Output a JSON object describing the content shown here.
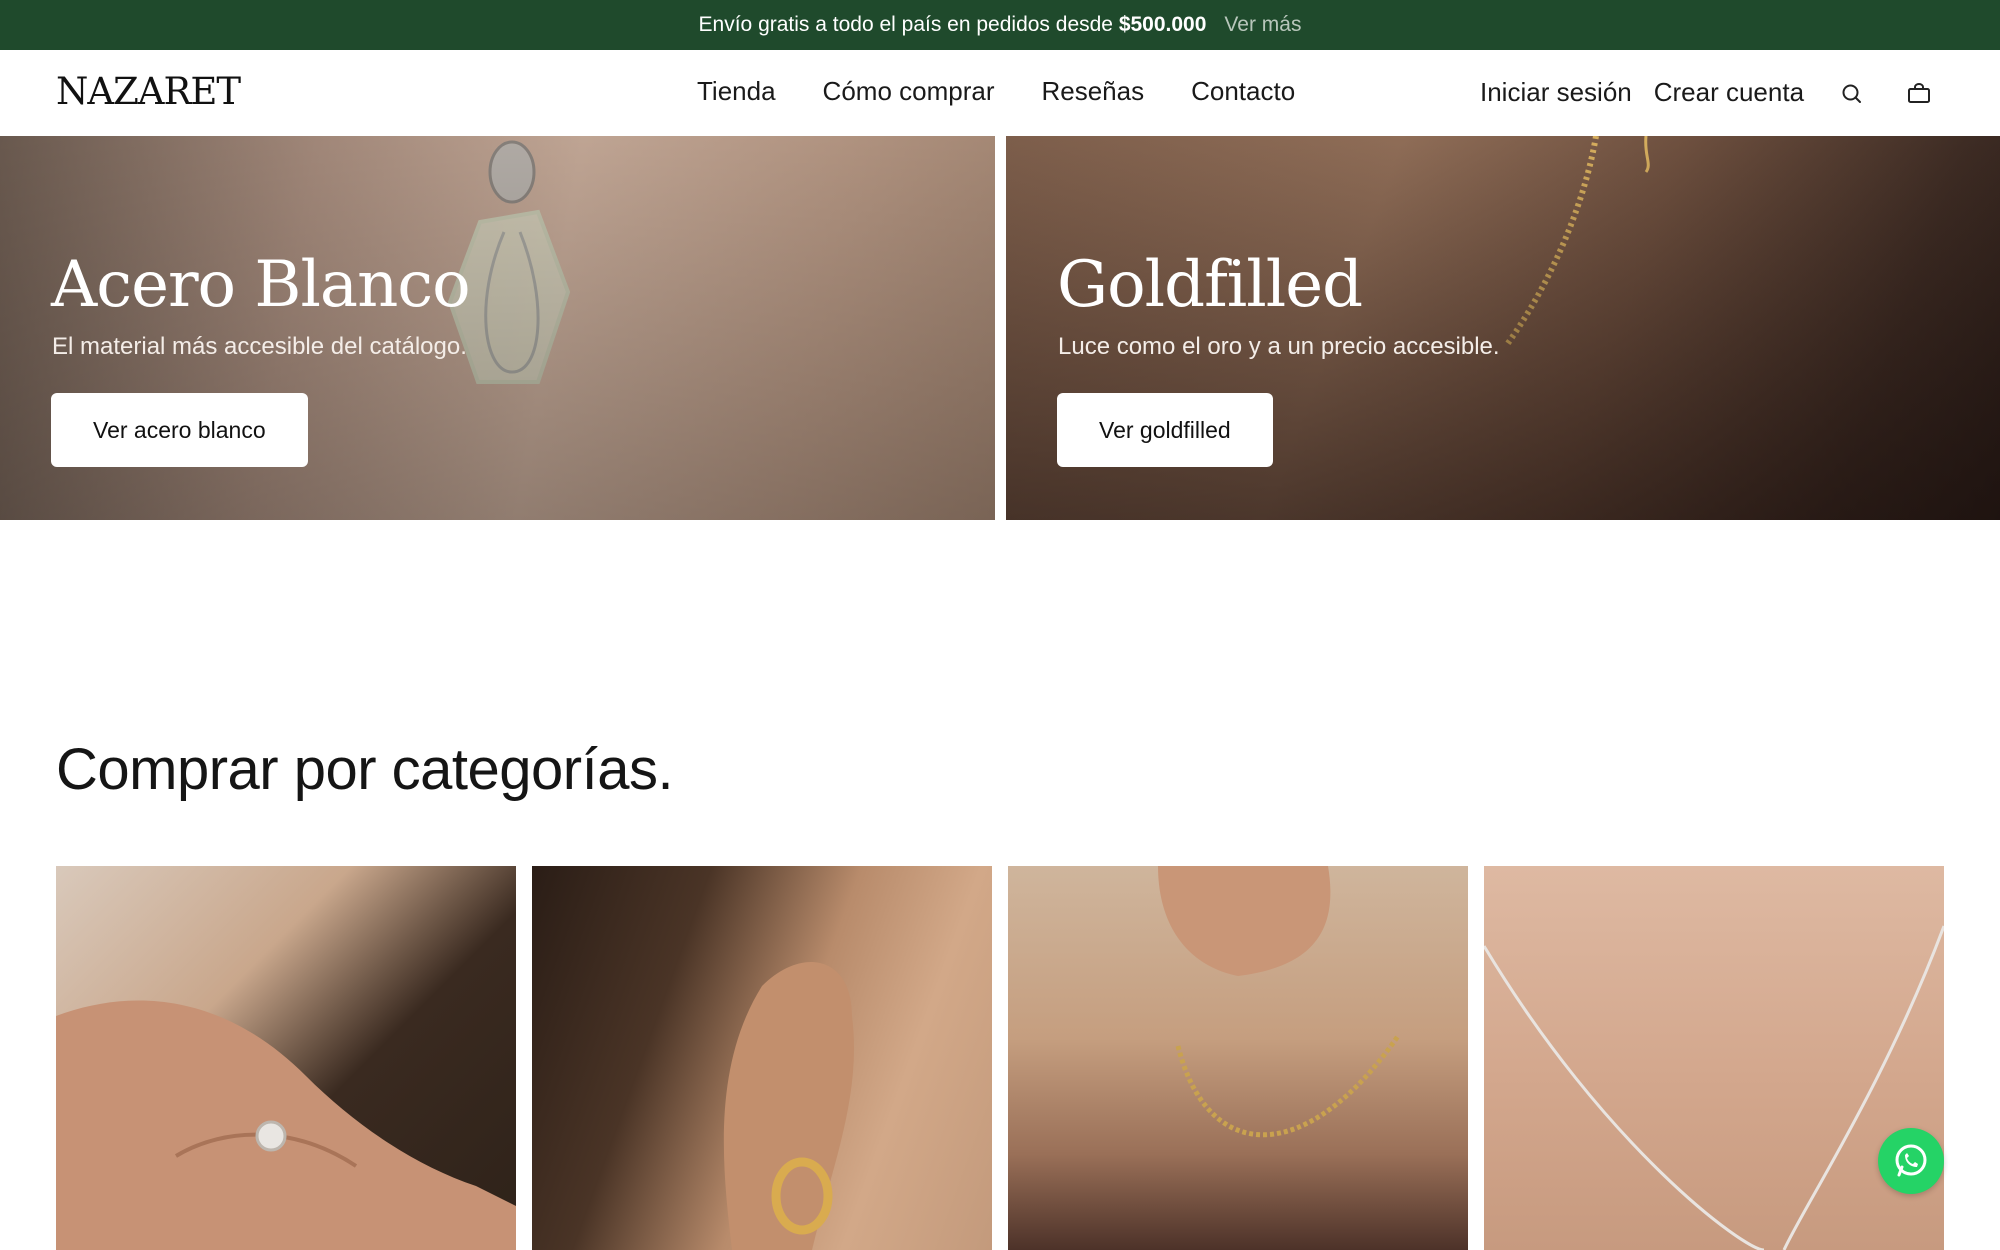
{
  "announcement": {
    "text": "Envío gratis a todo el país en pedidos desde",
    "amount": "$500.000",
    "link": "Ver más"
  },
  "header": {
    "logo": "NAZARET",
    "nav": [
      "Tienda",
      "Cómo comprar",
      "Reseñas",
      "Contacto"
    ],
    "login": "Iniciar sesión",
    "register": "Crear cuenta",
    "icons": [
      "search-icon",
      "cart-icon"
    ]
  },
  "hero": [
    {
      "title": "Acero Blanco",
      "subtitle": "El material más accesible del catálogo.",
      "button": "Ver acero blanco"
    },
    {
      "title": "Goldfilled",
      "subtitle": "Luce como el oro y a un precio accesible.",
      "button": "Ver goldfilled"
    }
  ],
  "categories": {
    "title": "Comprar por categorías.",
    "cards": [
      "ring-photo",
      "earring-photo",
      "gold-necklace-photo",
      "silver-necklace-photo"
    ]
  },
  "colors": {
    "announcement_bg": "#1f4a2c",
    "whatsapp": "#25d366"
  }
}
